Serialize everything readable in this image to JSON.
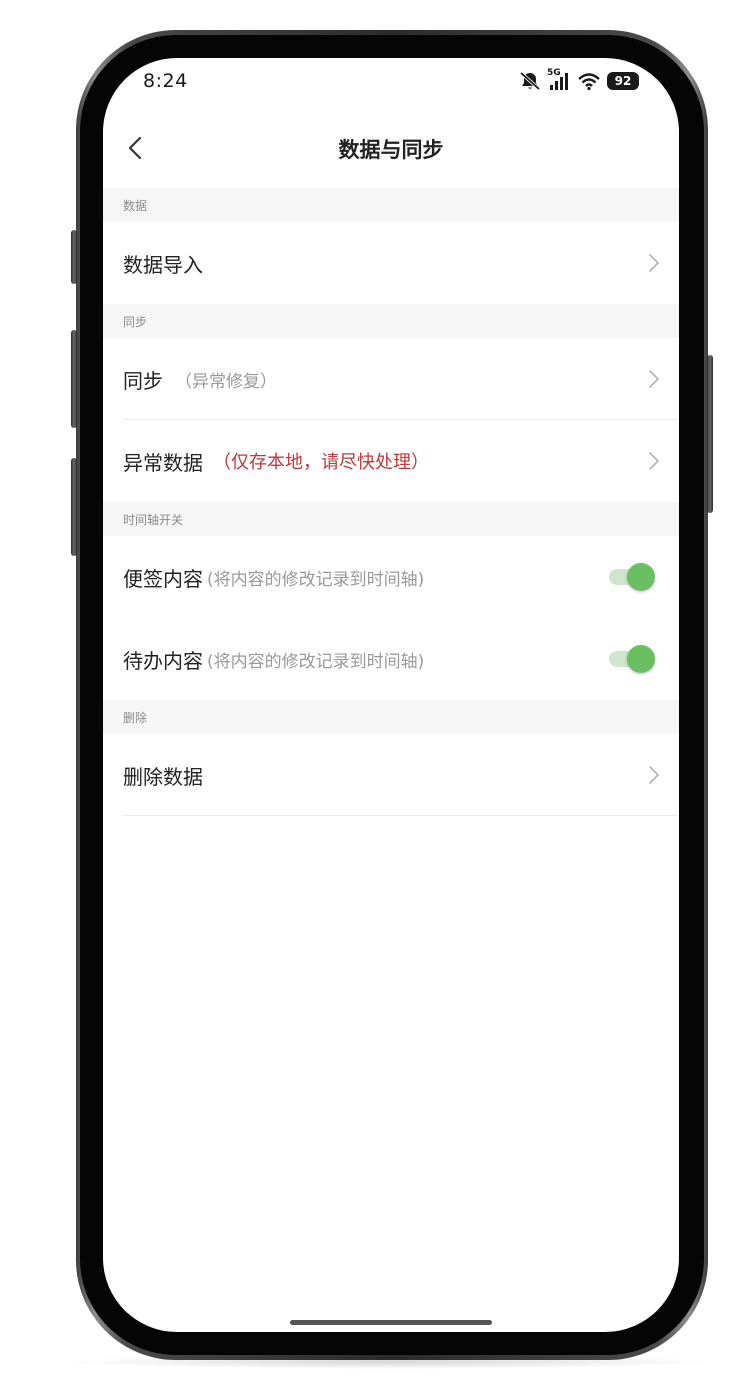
{
  "status_bar": {
    "time": "8:24",
    "network_label": "5G",
    "battery": "92",
    "icons": [
      "mute-icon",
      "signal-icon",
      "wifi-icon",
      "battery-icon"
    ]
  },
  "nav": {
    "title": "数据与同步",
    "back_icon": "chevron-left-icon"
  },
  "sections": {
    "data": {
      "header": "数据",
      "import_label": "数据导入"
    },
    "sync": {
      "header": "同步",
      "sync_label": "同步",
      "sync_hint": "（异常修复）",
      "abnormal_label": "异常数据",
      "abnormal_hint": "（仅存本地，请尽快处理）"
    },
    "timeline": {
      "header": "时间轴开关",
      "notes_label": "便签内容",
      "notes_hint": "(将内容的修改记录到时间轴)",
      "notes_enabled": true,
      "todo_label": "待办内容",
      "todo_hint": "(将内容的修改记录到时间轴)",
      "todo_enabled": true
    },
    "delete": {
      "header": "删除",
      "delete_label": "删除数据"
    }
  },
  "colors": {
    "accent_green": "#6bbf63",
    "warning_red": "#c0393b",
    "section_bg": "#f6f6f6"
  }
}
